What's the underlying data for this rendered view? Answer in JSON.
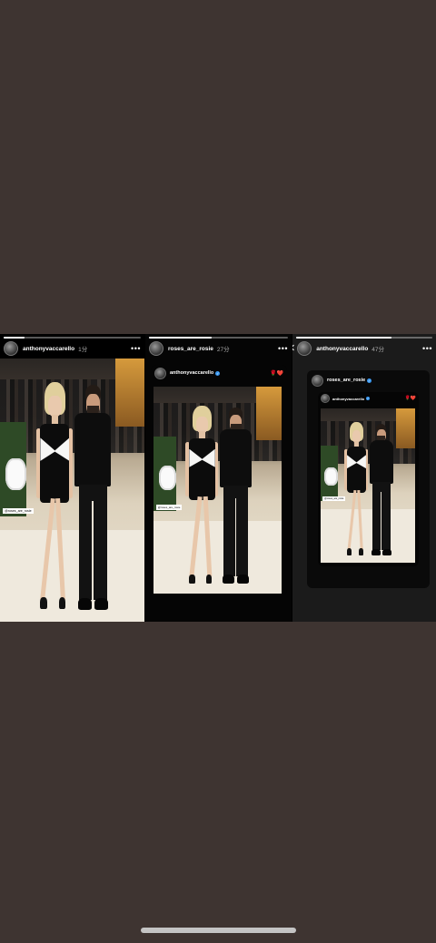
{
  "stories": [
    {
      "username": "anthonyvaccarello",
      "time": "1分",
      "more": "•••",
      "progress": 0.15,
      "tag": "@roses_are_rosie"
    },
    {
      "username": "roses_are_rosie",
      "time": "27分",
      "more": "•••",
      "progress": 0.45,
      "shared_username": "anthonyvaccarello",
      "hearts": "🌹❤️",
      "tag": "@roses_are_rosie"
    },
    {
      "username": "anthonyvaccarello",
      "time": "47分",
      "more": "•••",
      "progress": 0.7,
      "shared_username": "roses_are_rosie",
      "inner_username": "anthonyvaccarello",
      "hearts": "🌹❤️",
      "tag": "@roses_are_rosie"
    }
  ],
  "close_icon": "✕",
  "colors": {
    "background": "#3e3431",
    "verified": "#3897f0",
    "heart": "#e0252c"
  }
}
